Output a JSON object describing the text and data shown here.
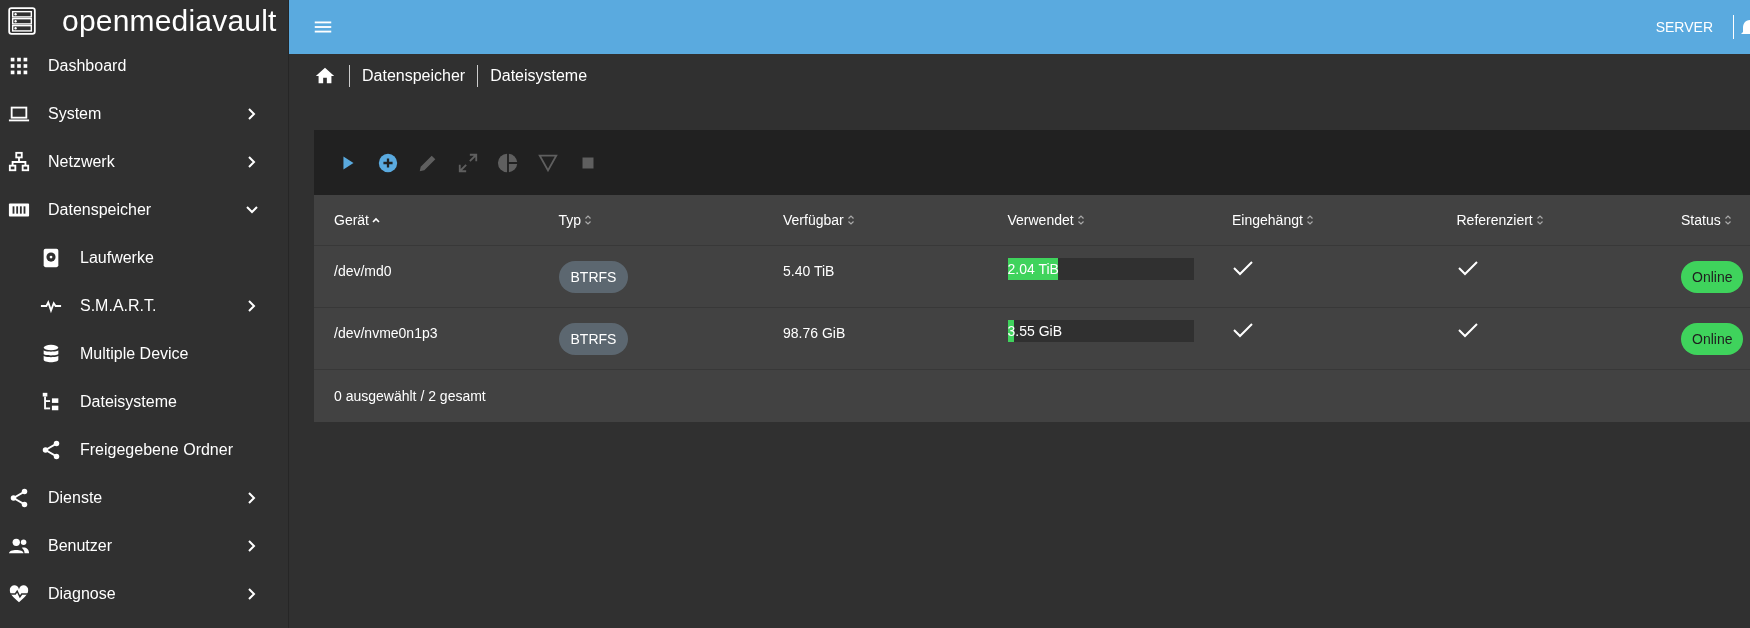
{
  "app": {
    "title": "openmediavault"
  },
  "topbar": {
    "server": "SERVER"
  },
  "sidebar": {
    "items": [
      {
        "label": "Dashboard"
      },
      {
        "label": "System",
        "expanded": false
      },
      {
        "label": "Netzwerk",
        "expanded": false
      },
      {
        "label": "Datenspeicher",
        "expanded": true,
        "children": [
          {
            "label": "Laufwerke"
          },
          {
            "label": "S.M.A.R.T.",
            "expanded": false
          },
          {
            "label": "Multiple Device"
          },
          {
            "label": "Dateisysteme"
          },
          {
            "label": "Freigegebene Ordner"
          }
        ]
      },
      {
        "label": "Dienste",
        "expanded": false
      },
      {
        "label": "Benutzer",
        "expanded": false
      },
      {
        "label": "Diagnose",
        "expanded": false
      }
    ]
  },
  "breadcrumb": [
    "Datenspeicher",
    "Dateisysteme"
  ],
  "toolbar": [
    {
      "disabled": false
    },
    {
      "disabled": false
    },
    {
      "disabled": true
    },
    {
      "disabled": true
    },
    {
      "disabled": true
    },
    {
      "disabled": true
    },
    {
      "disabled": true
    }
  ],
  "table": {
    "columns": [
      {
        "label": "Gerät",
        "sorted": true
      },
      {
        "label": "Typ",
        "sorted": false
      },
      {
        "label": "Verfügbar",
        "sorted": false
      },
      {
        "label": "Verwendet",
        "sorted": false
      },
      {
        "label": "Eingehängt",
        "sorted": false
      },
      {
        "label": "Referenziert",
        "sorted": false
      },
      {
        "label": "Status",
        "sorted": false
      }
    ],
    "rows": [
      {
        "device": "/dev/md0",
        "type": "BTRFS",
        "available": "5.40 TiB",
        "used": "2.04 TiB",
        "level": 0.27,
        "mounted": true,
        "referenced": true,
        "status": "Online",
        "color": "#3fd35c"
      },
      {
        "device": "/dev/nvme0n1p3",
        "type": "BTRFS",
        "available": "98.76 GiB",
        "used": "3.55 GiB",
        "level": 0.035,
        "mounted": true,
        "referenced": true,
        "status": "Online",
        "color": "#3fd35c"
      }
    ],
    "footer": "0 ausgewählt / 2 gesamt"
  }
}
